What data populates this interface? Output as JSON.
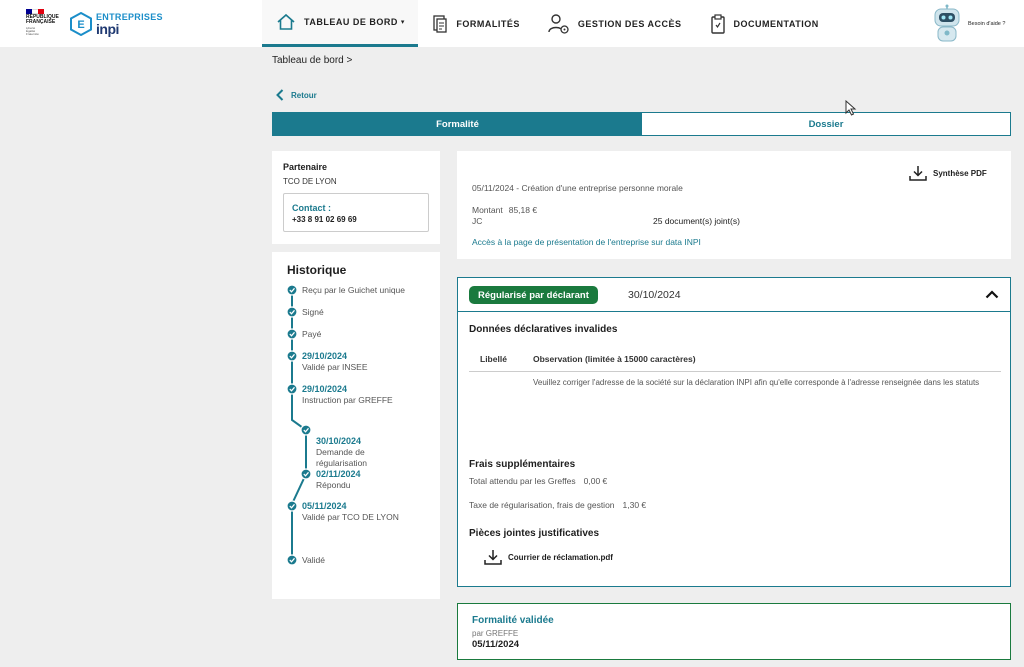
{
  "logo": {
    "rf_text": "RÉPUBLIQUE\nFRANÇAISE",
    "rf_motto": "Liberté\nÉgalité\nFraternité",
    "brand_top": "ENTREPRISES",
    "brand_bottom": "inpi"
  },
  "colors": {
    "accent": "#1b7a8e",
    "success": "#1a7a3e",
    "flag_blue": "#000091",
    "flag_red": "#e1000f"
  },
  "nav": {
    "items": [
      {
        "label": "TABLEAU DE BORD",
        "icon": "home-icon",
        "active": true,
        "caret": "▾"
      },
      {
        "label": "FORMALITÉS",
        "icon": "document-stack-icon",
        "active": false
      },
      {
        "label": "GESTION DES ACCÈS",
        "icon": "user-settings-icon",
        "active": false
      },
      {
        "label": "DOCUMENTATION",
        "icon": "clipboard-icon",
        "active": false
      }
    ],
    "help_label": "Besoin d'aide ?"
  },
  "breadcrumb": "Tableau de bord  >",
  "back_label": "Retour",
  "tabs": [
    {
      "label": "Formalité",
      "active": true
    },
    {
      "label": "Dossier",
      "active": false
    }
  ],
  "partner": {
    "title": "Partenaire",
    "value": "TCO DE LYON",
    "contact_title": "Contact :",
    "contact_phone": "+33 8 91 02 69 69"
  },
  "history": {
    "title": "Historique",
    "items": [
      {
        "date": "",
        "label": "Reçu par le Guichet unique"
      },
      {
        "date": "",
        "label": "Signé"
      },
      {
        "date": "",
        "label": "Payé"
      },
      {
        "date": "29/10/2024",
        "label": "Validé par INSEE"
      },
      {
        "date": "29/10/2024",
        "label": "Instruction par GREFFE"
      },
      {
        "date": "30/10/2024",
        "label": "Demande de\nrégularisation"
      },
      {
        "date": "02/11/2024",
        "label": "Répondu"
      },
      {
        "date": "05/11/2024",
        "label": "Validé par TCO DE LYON"
      },
      {
        "date": "",
        "label": "Validé"
      }
    ]
  },
  "summary": {
    "pdf_label": "Synthèse PDF",
    "line1": "05/11/2024 - Création d'une entreprise personne morale",
    "amount_label": "Montant",
    "amount_value": "85,18 €",
    "jc_label": "JC",
    "docs": "25 document(s) joint(s)",
    "link": "Accès à la page de présentation de l'entreprise sur data INPI"
  },
  "regul": {
    "status": "Régularisé par déclarant",
    "date": "30/10/2024",
    "invalid_title": "Données déclaratives invalides",
    "col_label": "Libellé",
    "col_observation": "Observation (limitée à 15000 caractères)",
    "observation": "Veuillez corriger l'adresse de la société sur la déclaration INPI afin qu'elle corresponde à l'adresse renseignée dans les statuts",
    "fees_title": "Frais supplémentaires",
    "fee1_label": "Total attendu par les Greffes",
    "fee1_value": "0,00 €",
    "fee2_label": "Taxe de régularisation, frais de gestion",
    "fee2_value": "1,30 €",
    "attachments_title": "Pièces jointes justificatives",
    "file_name": "Courrier de réclamation.pdf"
  },
  "validated": {
    "title": "Formalité validée",
    "by": "par GREFFE",
    "date": "05/11/2024"
  }
}
